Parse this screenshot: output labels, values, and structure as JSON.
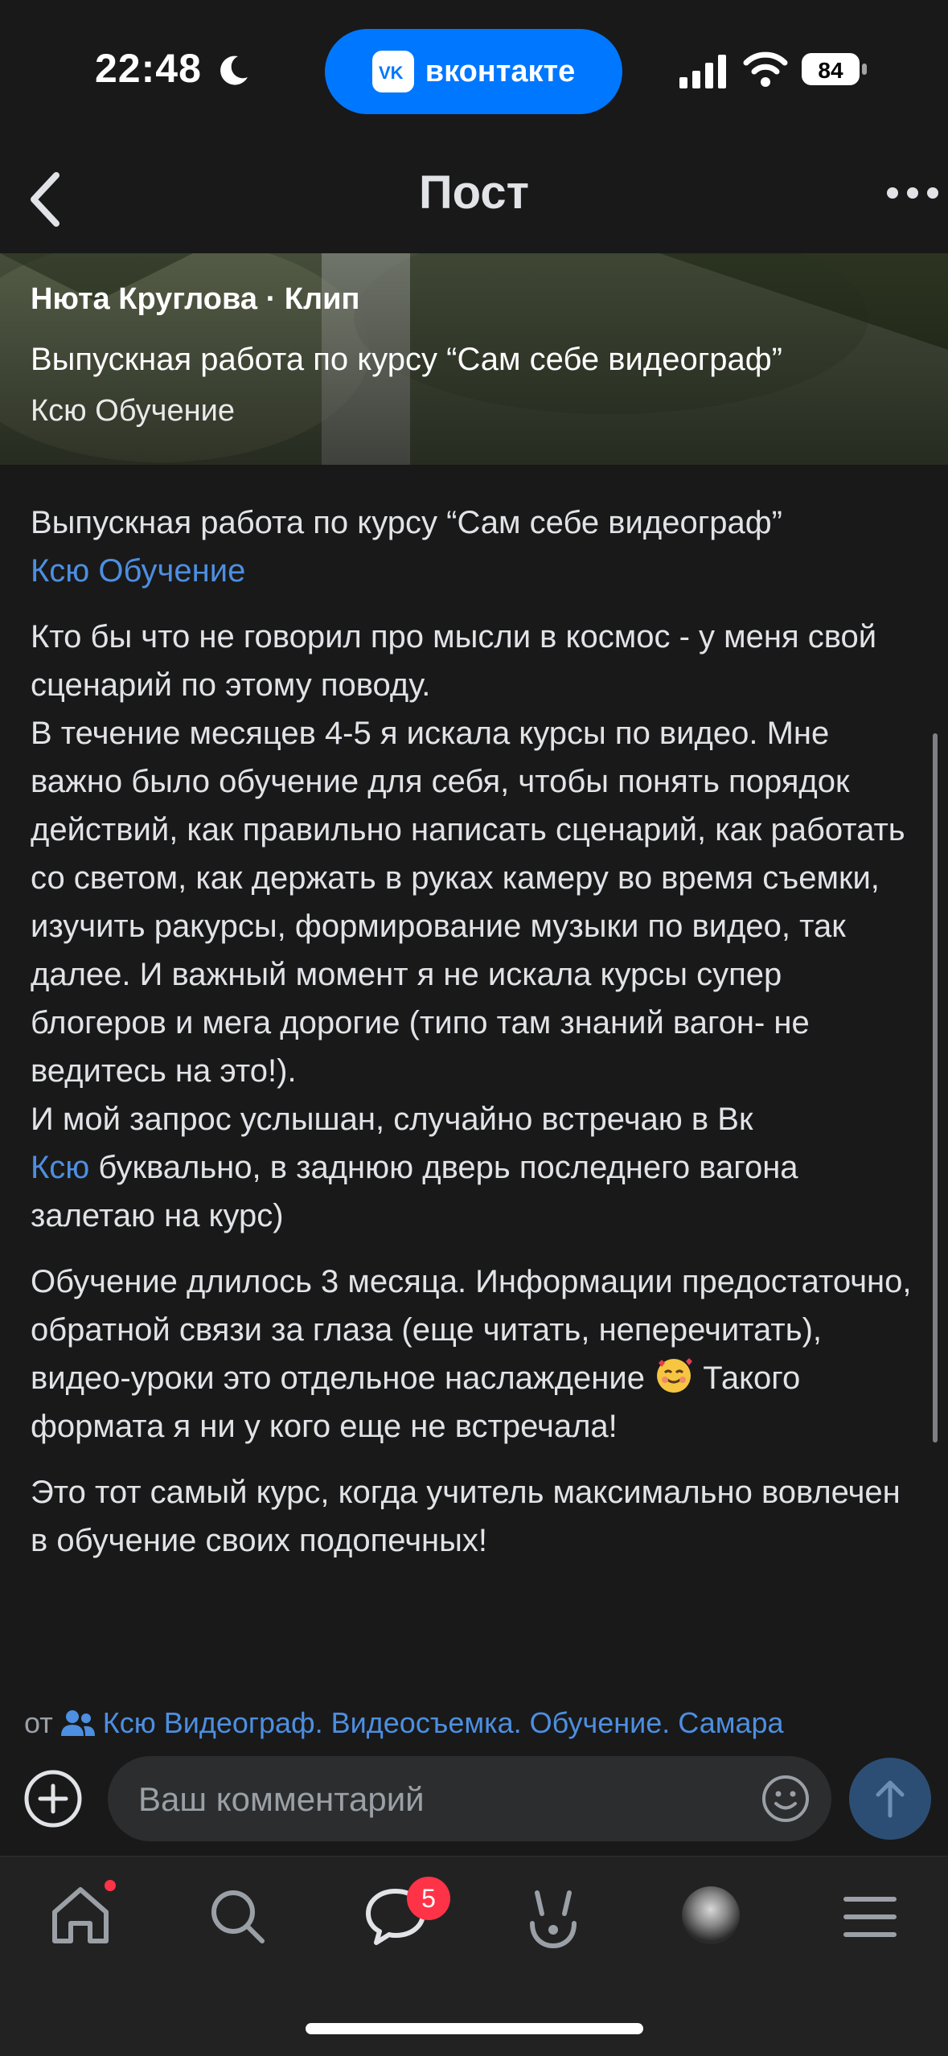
{
  "status": {
    "time": "22:48",
    "app_pill_label": "вконтакте",
    "battery": "84"
  },
  "header": {
    "title": "Пост"
  },
  "media": {
    "author": "Нюта Круглова · Клип",
    "title": "Выпускная работа по курсу “Сам себе видеограф”",
    "subtitle": "Ксю Обучение"
  },
  "post": {
    "p1_line": "Выпускная работа по курсу “Сам себе видеограф”",
    "p1_link": "Ксю Обучение",
    "p2_text": "Кто бы что не говорил про мысли в космос - у меня свой сценарий по этому поводу.\nВ течение месяцев 4-5 я искала курсы по видео. Мне важно было обучение для себя, чтобы понять порядок действий, как правильно написать сценарий, как работать со светом, как держать в руках камеру во время съемки, изучить ракурсы, формирование музыки по видео, так далее. И важный момент я не искала курсы супер блогеров и мега дорогие (типо там знаний вагон- не ведитесь на это!).\nИ мой запрос услышан, случайно встречаю в Вк",
    "p2_link": "Ксю",
    "p2_tail": " буквально, в заднюю дверь последнего вагона залетаю на курс)",
    "p3_text": "Обучение длилось 3 месяца. Информации предостаточно, обратной связи за глаза (еще читать, неперечитать), видео-уроки это отдельное наслаждение",
    "p3_tail": " Такого формата я ни у кого еще не встречала!",
    "p4_text": "Это тот самый курс, когда учитель максимально вовлечен в обучение своих подопечных!"
  },
  "source": {
    "prefix": "от",
    "group": "Ксю Видеограф. Видеосъемка. Обучение. Самара"
  },
  "comment": {
    "placeholder": "Ваш комментарий"
  },
  "tabs": {
    "messages_badge": "5"
  },
  "colors": {
    "accent": "#0077ff",
    "link": "#4d8fe0",
    "badge": "#ff3347",
    "background": "#19191a"
  }
}
